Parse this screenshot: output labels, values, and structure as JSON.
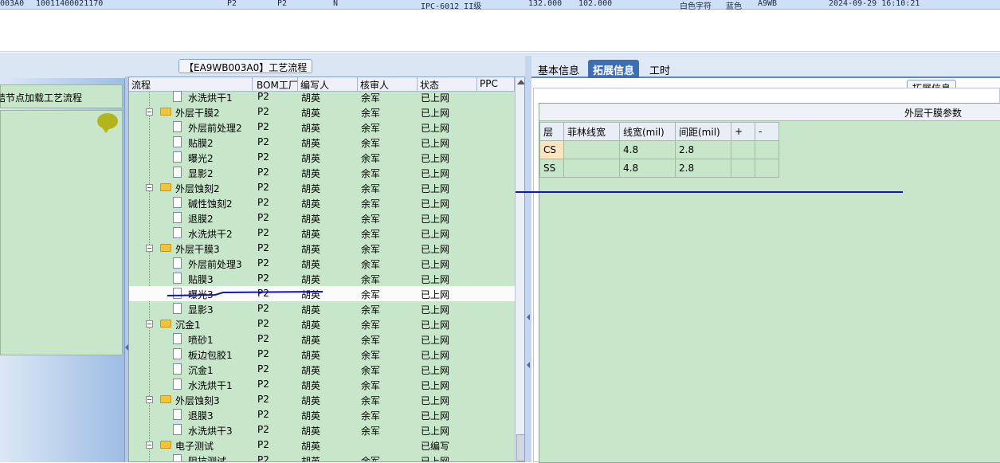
{
  "top_row": {
    "cells": [
      "003A0",
      "10011400021170",
      "P2",
      "P2",
      "N",
      "IPC-6012 II级",
      "132.000",
      "102.000",
      "白色字符",
      "蓝色",
      "A9WB",
      "2024-09-29 16:10:21"
    ]
  },
  "left_panel": {
    "hint_text": "结节点加载工艺流程",
    "bubble_icon": "speech-bubble-icon"
  },
  "center": {
    "title": "【EA9WB003A0】工艺流程",
    "columns": [
      "流程",
      "BOM工厂",
      "编写人",
      "核审人",
      "状态",
      "PPC"
    ],
    "rows": [
      {
        "level": 1,
        "kind": "file",
        "name": "水洗烘干1",
        "bom": "P2",
        "writer": "胡英",
        "reviewer": "余军",
        "status": "已上网"
      },
      {
        "level": 0,
        "kind": "folder",
        "name": "外层干膜2",
        "bom": "P2",
        "writer": "胡英",
        "reviewer": "余军",
        "status": "已上网"
      },
      {
        "level": 1,
        "kind": "file",
        "name": "外层前处理2",
        "bom": "P2",
        "writer": "胡英",
        "reviewer": "余军",
        "status": "已上网"
      },
      {
        "level": 1,
        "kind": "file",
        "name": "贴膜2",
        "bom": "P2",
        "writer": "胡英",
        "reviewer": "余军",
        "status": "已上网"
      },
      {
        "level": 1,
        "kind": "file",
        "name": "曝光2",
        "bom": "P2",
        "writer": "胡英",
        "reviewer": "余军",
        "status": "已上网"
      },
      {
        "level": 1,
        "kind": "file",
        "name": "显影2",
        "bom": "P2",
        "writer": "胡英",
        "reviewer": "余军",
        "status": "已上网"
      },
      {
        "level": 0,
        "kind": "folder",
        "name": "外层蚀刻2",
        "bom": "P2",
        "writer": "胡英",
        "reviewer": "余军",
        "status": "已上网"
      },
      {
        "level": 1,
        "kind": "file",
        "name": "碱性蚀刻2",
        "bom": "P2",
        "writer": "胡英",
        "reviewer": "余军",
        "status": "已上网"
      },
      {
        "level": 1,
        "kind": "file",
        "name": "退膜2",
        "bom": "P2",
        "writer": "胡英",
        "reviewer": "余军",
        "status": "已上网"
      },
      {
        "level": 1,
        "kind": "file",
        "name": "水洗烘干2",
        "bom": "P2",
        "writer": "胡英",
        "reviewer": "余军",
        "status": "已上网"
      },
      {
        "level": 0,
        "kind": "folder",
        "name": "外层干膜3",
        "bom": "P2",
        "writer": "胡英",
        "reviewer": "余军",
        "status": "已上网"
      },
      {
        "level": 1,
        "kind": "file",
        "name": "外层前处理3",
        "bom": "P2",
        "writer": "胡英",
        "reviewer": "余军",
        "status": "已上网"
      },
      {
        "level": 1,
        "kind": "file",
        "name": "贴膜3",
        "bom": "P2",
        "writer": "胡英",
        "reviewer": "余军",
        "status": "已上网"
      },
      {
        "level": 1,
        "kind": "file",
        "name": "曝光3",
        "bom": "P2",
        "writer": "胡英",
        "reviewer": "余军",
        "status": "已上网",
        "selected": true
      },
      {
        "level": 1,
        "kind": "file",
        "name": "显影3",
        "bom": "P2",
        "writer": "胡英",
        "reviewer": "余军",
        "status": "已上网"
      },
      {
        "level": 0,
        "kind": "folder",
        "name": "沉金1",
        "bom": "P2",
        "writer": "胡英",
        "reviewer": "余军",
        "status": "已上网"
      },
      {
        "level": 1,
        "kind": "file",
        "name": "喷砂1",
        "bom": "P2",
        "writer": "胡英",
        "reviewer": "余军",
        "status": "已上网"
      },
      {
        "level": 1,
        "kind": "file",
        "name": "板边包胶1",
        "bom": "P2",
        "writer": "胡英",
        "reviewer": "余军",
        "status": "已上网"
      },
      {
        "level": 1,
        "kind": "file",
        "name": "沉金1",
        "bom": "P2",
        "writer": "胡英",
        "reviewer": "余军",
        "status": "已上网"
      },
      {
        "level": 1,
        "kind": "file",
        "name": "水洗烘干1",
        "bom": "P2",
        "writer": "胡英",
        "reviewer": "余军",
        "status": "已上网"
      },
      {
        "level": 0,
        "kind": "folder",
        "name": "外层蚀刻3",
        "bom": "P2",
        "writer": "胡英",
        "reviewer": "余军",
        "status": "已上网"
      },
      {
        "level": 1,
        "kind": "file",
        "name": "退膜3",
        "bom": "P2",
        "writer": "胡英",
        "reviewer": "余军",
        "status": "已上网"
      },
      {
        "level": 1,
        "kind": "file",
        "name": "水洗烘干3",
        "bom": "P2",
        "writer": "胡英",
        "reviewer": "余军",
        "status": "已上网"
      },
      {
        "level": 0,
        "kind": "folder",
        "name": "电子测试",
        "bom": "P2",
        "writer": "胡英",
        "reviewer": "",
        "status": "已编写"
      },
      {
        "level": 1,
        "kind": "file",
        "name": "阻抗测试",
        "bom": "P2",
        "writer": "胡英",
        "reviewer": "余军",
        "status": "已上网"
      }
    ]
  },
  "right": {
    "tabs": [
      "基本信息",
      "拓展信息",
      "工时"
    ],
    "active_tab": "拓展信息",
    "section_title": "拓展信息",
    "param_title": "外层干膜参数",
    "table_header": [
      "层",
      "菲林线宽",
      "线宽(mil)",
      "间距(mil)",
      "+",
      "-"
    ],
    "table_rows": [
      [
        "CS",
        "",
        "4.8",
        "2.8",
        "",
        ""
      ],
      [
        "SS",
        "",
        "4.8",
        "2.8",
        "",
        ""
      ]
    ]
  },
  "colors": {
    "green_bg": "#c8e6c9",
    "accent_tab": "#3d6fb6",
    "annotation": "#1414b8"
  }
}
